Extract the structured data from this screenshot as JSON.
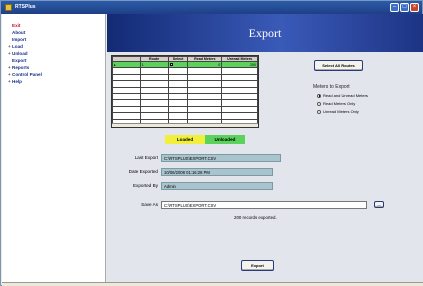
{
  "window": {
    "title": "RTSPlus"
  },
  "sidebar": {
    "items": [
      {
        "label": "Exit",
        "expandable": false
      },
      {
        "label": "About",
        "expandable": false
      },
      {
        "label": "Import",
        "expandable": false
      },
      {
        "label": "Load",
        "expandable": true
      },
      {
        "label": "Unload",
        "expandable": true
      },
      {
        "label": "Export",
        "expandable": false
      },
      {
        "label": "Reports",
        "expandable": true
      },
      {
        "label": "Control Panel",
        "expandable": true
      },
      {
        "label": "Help",
        "expandable": true
      }
    ]
  },
  "page": {
    "title": "Export"
  },
  "grid": {
    "columns": [
      "Route",
      "Select",
      "Read Meters",
      "Unread Meters"
    ],
    "rows": [
      {
        "route": "1",
        "selected": true,
        "read": "0",
        "unread": "200",
        "highlight": true
      }
    ],
    "empty_rows": 9
  },
  "legend": {
    "loaded": "Loaded",
    "unloaded": "Unloaded"
  },
  "buttons": {
    "select_all": "Select All Routes",
    "export": "Export",
    "browse": "..."
  },
  "meters_to_export": {
    "title": "Meters to Export",
    "options": [
      "Read and Unread Meters",
      "Read Meters Only",
      "Unread Meters Only"
    ],
    "selected": 0
  },
  "info": {
    "last_export_label": "Last Export",
    "last_export_value": "C:\\RTSPLUS\\EXPORT.CSV",
    "date_exported_label": "Date Exported",
    "date_exported_value": "10/06/2008 01:16:28 PM",
    "exported_by_label": "Exported By",
    "exported_by_value": "Admin"
  },
  "save_as": {
    "label": "Save As",
    "value": "C:\\RTSPLUS\\EXPORT.CSV"
  },
  "status": "200 records exported."
}
